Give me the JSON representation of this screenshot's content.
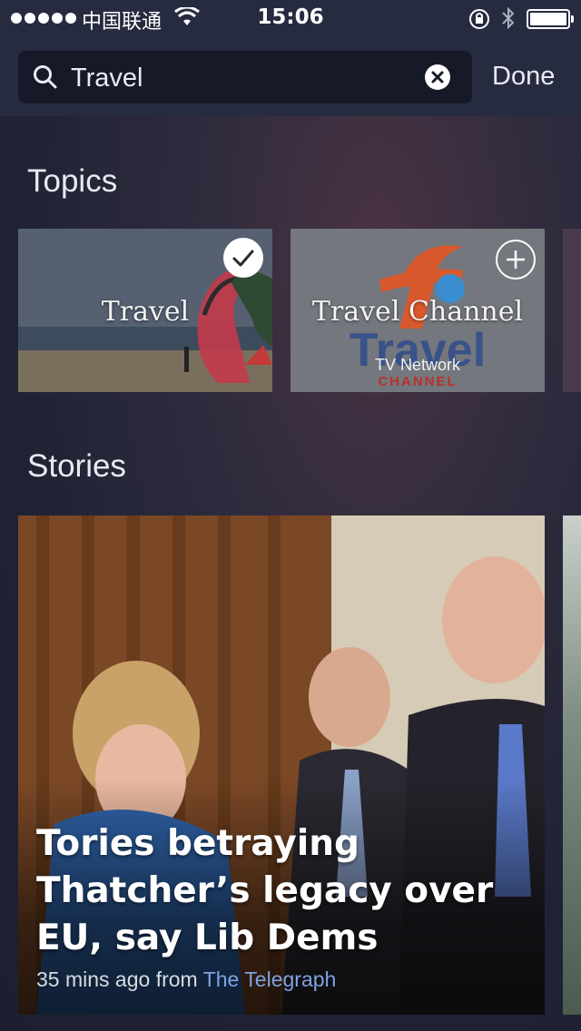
{
  "status_bar": {
    "carrier": "中国联通",
    "time": "15:06"
  },
  "search": {
    "query": "Travel",
    "done_label": "Done"
  },
  "topics": {
    "heading": "Topics",
    "items": [
      {
        "label": "Travel",
        "subtitle": "",
        "selected": true
      },
      {
        "label": "Travel Channel",
        "subtitle": "TV Network",
        "selected": false,
        "logo_word": "Travel",
        "logo_sub": "CHANNEL"
      }
    ]
  },
  "stories": {
    "heading": "Stories",
    "items": [
      {
        "headline": "Tories betraying Thatcher’s legacy over EU, say Lib Dems",
        "time_ago": "35 mins ago from",
        "source": "The Telegraph"
      }
    ]
  },
  "colors": {
    "source_link": "#7ea3e0",
    "background": "#1f2233",
    "header": "#262b40"
  }
}
